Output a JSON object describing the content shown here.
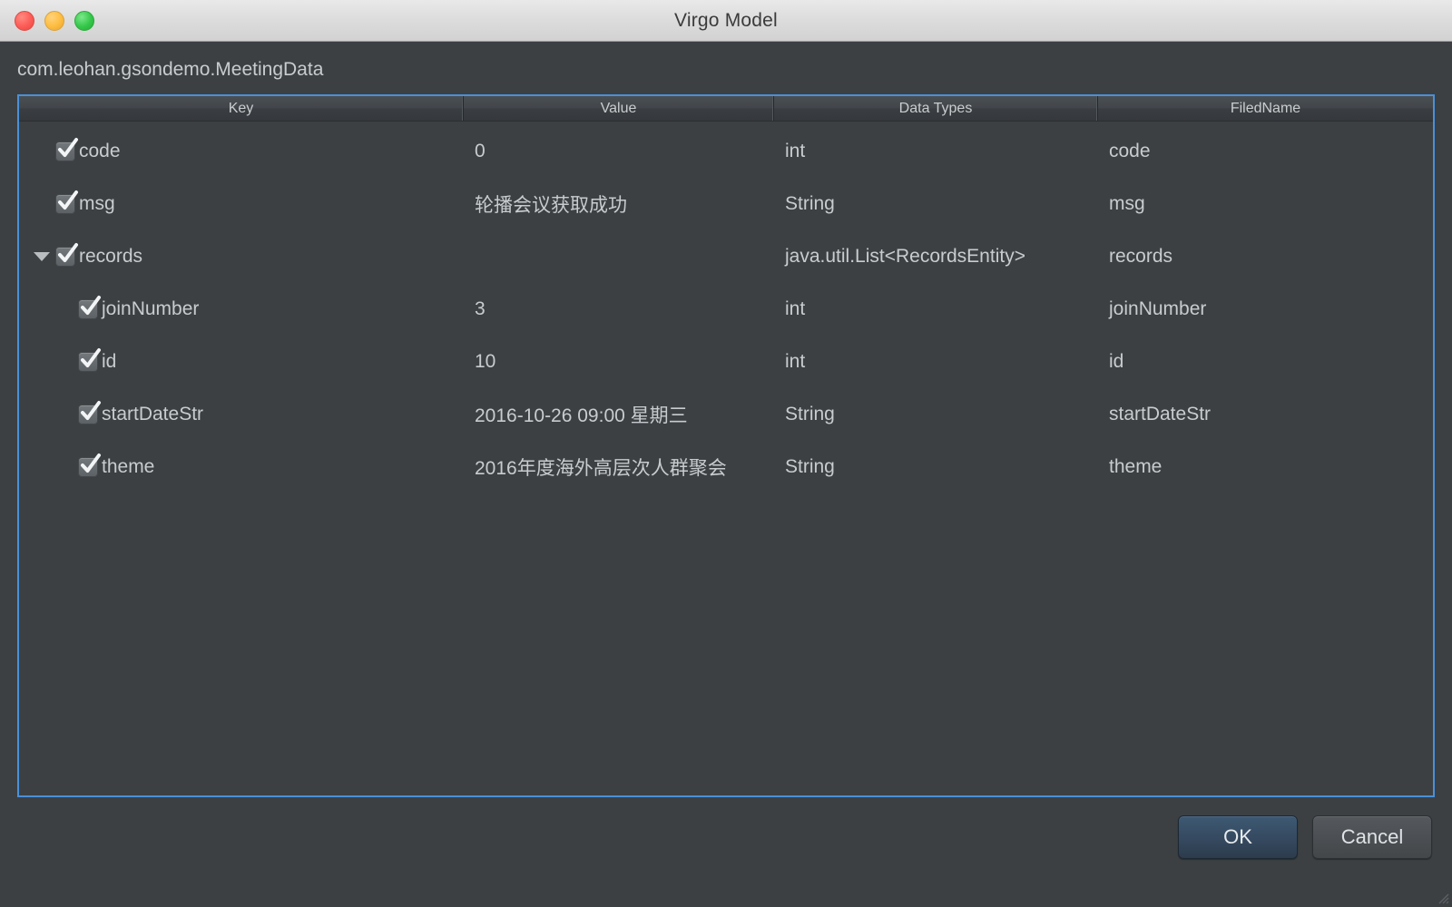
{
  "window": {
    "title": "Virgo Model",
    "traffic_lights": [
      "close-button",
      "minimize-button",
      "maximize-button"
    ],
    "accent_border_color": "#4a90d9",
    "background_color": "#3c4043"
  },
  "class_name": "com.leohan.gsondemo.MeetingData",
  "table": {
    "columns": [
      {
        "id": "key",
        "label": "Key"
      },
      {
        "id": "value",
        "label": "Value"
      },
      {
        "id": "type",
        "label": "Data Types"
      },
      {
        "id": "field",
        "label": "FiledName"
      }
    ],
    "rows": [
      {
        "key": "code",
        "value": "0",
        "type": "int",
        "field": "code",
        "checked": true,
        "level": 0,
        "expandable": false,
        "expanded": false
      },
      {
        "key": "msg",
        "value": "轮播会议获取成功",
        "type": "String",
        "field": "msg",
        "checked": true,
        "level": 0,
        "expandable": false,
        "expanded": false
      },
      {
        "key": "records",
        "value": "",
        "type": "java.util.List<RecordsEntity>",
        "field": "records",
        "checked": true,
        "level": 0,
        "expandable": true,
        "expanded": true
      },
      {
        "key": "joinNumber",
        "value": "3",
        "type": "int",
        "field": "joinNumber",
        "checked": true,
        "level": 1,
        "expandable": false,
        "expanded": false
      },
      {
        "key": "id",
        "value": "10",
        "type": "int",
        "field": "id",
        "checked": true,
        "level": 1,
        "expandable": false,
        "expanded": false
      },
      {
        "key": "startDateStr",
        "value": "2016-10-26 09:00 星期三",
        "type": "String",
        "field": "startDateStr",
        "checked": true,
        "level": 1,
        "expandable": false,
        "expanded": false
      },
      {
        "key": "theme",
        "value": "2016年度海外高层次人群聚会",
        "type": "String",
        "field": "theme",
        "checked": true,
        "level": 1,
        "expandable": false,
        "expanded": false
      }
    ]
  },
  "footer": {
    "ok_label": "OK",
    "cancel_label": "Cancel"
  }
}
